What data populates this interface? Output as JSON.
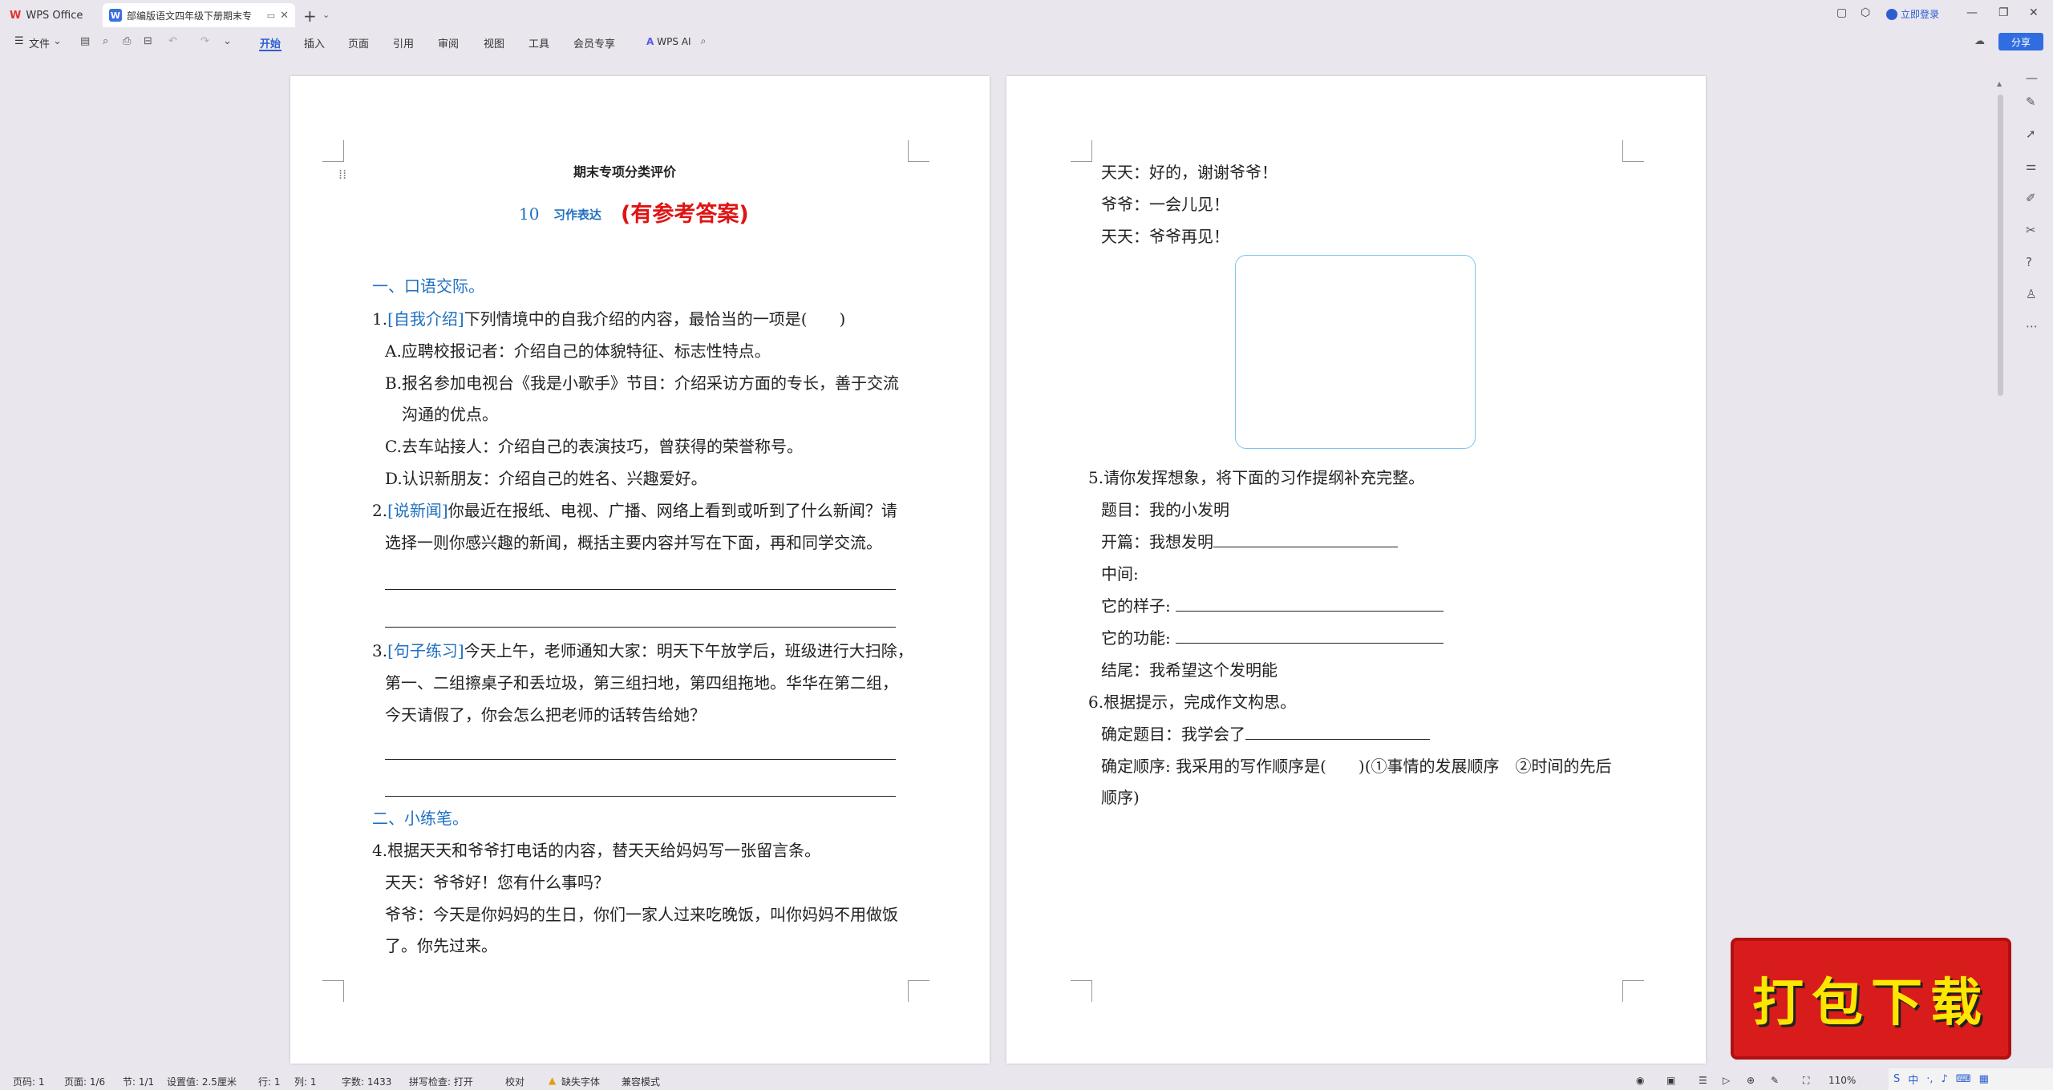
{
  "titlebar": {
    "app_tab_label": "WPS Office",
    "doc_tab_label": "部编版语文四年级下册期末专",
    "login_label": "立即登录"
  },
  "menubar": {
    "file_label": "文件",
    "items": [
      "开始",
      "插入",
      "页面",
      "引用",
      "审阅",
      "视图",
      "工具",
      "会员专享"
    ],
    "ai_label": "WPS AI",
    "share_label": "分享"
  },
  "page1": {
    "title": "期末专项分类评价",
    "subtitle_num": "10",
    "subtitle_text": "习作表达",
    "subtitle_red": "(有参考答案)",
    "section1": "一、口语交际。",
    "q1_num": "1.",
    "q1_tag": "[自我介绍]",
    "q1_text": "下列情境中的自我介绍的内容，最恰当的一项是(　　)",
    "q1_a": "A.应聘校报记者：介绍自己的体貌特征、标志性特点。",
    "q1_b1": "B.报名参加电视台《我是小歌手》节目：介绍采访方面的专长，善于交流",
    "q1_b2": "沟通的优点。",
    "q1_c": "C.去车站接人：介绍自己的表演技巧，曾获得的荣誉称号。",
    "q1_d": "D.认识新朋友：介绍自己的姓名、兴趣爱好。",
    "q2_num": "2.",
    "q2_tag": "[说新闻]",
    "q2_text1": "你最近在报纸、电视、广播、网络上看到或听到了什么新闻？请",
    "q2_text2": "选择一则你感兴趣的新闻，概括主要内容并写在下面，再和同学交流。",
    "q3_num": "3.",
    "q3_tag": "[句子练习]",
    "q3_text1": "今天上午，老师通知大家：明天下午放学后，班级进行大扫除，",
    "q3_text2": "第一、二组擦桌子和丢垃圾，第三组扫地，第四组拖地。华华在第二组，",
    "q3_text3": "今天请假了，你会怎么把老师的话转告给她？",
    "section2": "二、小练笔。",
    "q4_text": "4.根据天天和爷爷打电话的内容，替天天给妈妈写一张留言条。",
    "q4_l1": "天天：爷爷好！您有什么事吗？",
    "q4_l2a": "爷爷：今天是你妈妈的生日，你们一家人过来吃晚饭，叫你妈妈不用做饭",
    "q4_l2b": "了。你先过来。"
  },
  "page2": {
    "l1": "天天：好的，谢谢爷爷！",
    "l2": "爷爷：一会儿见！",
    "l3": "天天：爷爷再见！",
    "q5_text": "5.请你发挥想象，将下面的习作提纲补充完整。",
    "q5_title": "题目：我的小发明",
    "q5_open": "开篇：我想发明",
    "q5_mid": "中间:",
    "q5_look": "它的样子:",
    "q5_func": "它的功能:",
    "q5_end": "结尾：我希望这个发明能",
    "q6_text": "6.根据提示，完成作文构思。",
    "q6_title": "确定题目：我学会了",
    "q6_order1": "确定顺序: 我采用的写作顺序是(　　)(①事情的发展顺序　②时间的先后",
    "q6_order2": "顺序)"
  },
  "statusbar": {
    "page_code": "页码: 1",
    "page": "页面: 1/6",
    "section": "节: 1/1",
    "setting": "设置值: 2.5厘米",
    "row": "行: 1",
    "col": "列: 1",
    "words": "字数: 1433",
    "spell": "拼写检查: 打开",
    "proof": "校对",
    "missing_font": "缺失字体",
    "compat": "兼容模式",
    "zoom": "110%"
  },
  "badge": {
    "text": "打包下载"
  }
}
